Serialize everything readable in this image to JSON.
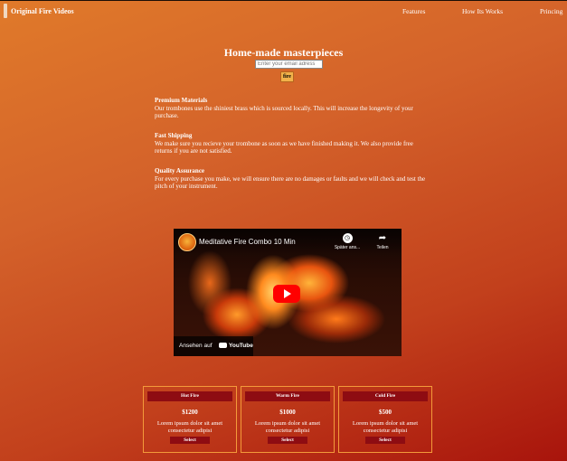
{
  "header": {
    "brand": "Original Fire Videos",
    "nav": [
      "Features",
      "How Its Works",
      "Princing"
    ]
  },
  "hero": {
    "title": "Home-made masterpieces",
    "email_placeholder": "Enter your email adress",
    "submit_label": "fire"
  },
  "features": [
    {
      "title": "Premium Materials",
      "text": "Our trombones use the shiniest brass which is sourced locally. This will increase the longevity of your purchase."
    },
    {
      "title": "Fast Shipping",
      "text": "We make sure you recieve your trombone as soon as we have finished making it. We also provide free returns if you are not satisfied."
    },
    {
      "title": "Quality Assurance",
      "text": "For every purchase you make, we will ensure there are no damages or faults and we will check and test the pitch of your instrument."
    }
  ],
  "video": {
    "title": "Meditative Fire Combo 10 Min",
    "watch_later": "Später ans...",
    "share": "Teilen",
    "watch_on": "Ansehen auf",
    "platform": "YouTube"
  },
  "pricing": [
    {
      "name": "Hot Fire",
      "price": "$1200",
      "desc": "Lorem ipsum dolor sit amet consectetur adipisi",
      "button": "Select"
    },
    {
      "name": "Warm Fire",
      "price": "$1000",
      "desc": "Lorem ipsum dolor sit amet consectetur adipisi",
      "button": "Select"
    },
    {
      "name": "Cold Fire",
      "price": "$500",
      "desc": "Lorem ipsum dolor sit amet consectetur adipisi",
      "button": "Select"
    }
  ],
  "colors": {
    "accent": "#8e0c12",
    "button": "#f2b24a",
    "card_border": "#f39a3a"
  }
}
